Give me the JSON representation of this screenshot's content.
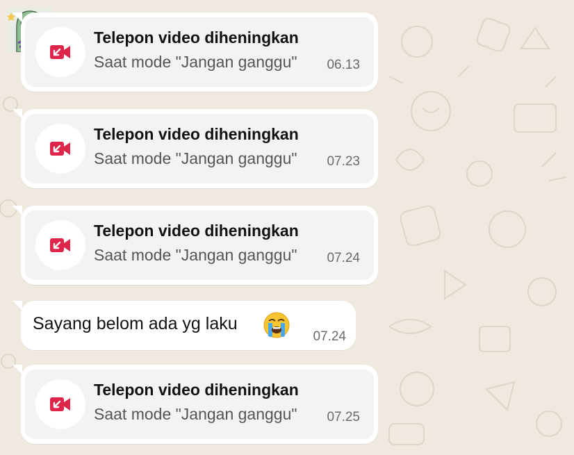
{
  "colors": {
    "background": "#efe9e0",
    "bubble": "#ffffff",
    "call_card": "#f4f3f2",
    "missed_call_icon": "#e0254a",
    "timestamp": "#6a6a6a"
  },
  "avatar": {
    "icon": "green-cartoon-sticker-avatar"
  },
  "messages": [
    {
      "type": "call",
      "title": "Telepon video diheningkan",
      "subtitle": "Saat mode \"Jangan ganggu\"",
      "time": "06.13",
      "icon": "video-call-missed-icon"
    },
    {
      "type": "call",
      "title": "Telepon video diheningkan",
      "subtitle": "Saat mode \"Jangan ganggu\"",
      "time": "07.23",
      "icon": "video-call-missed-icon"
    },
    {
      "type": "call",
      "title": "Telepon video diheningkan",
      "subtitle": "Saat mode \"Jangan ganggu\"",
      "time": "07.24",
      "icon": "video-call-missed-icon"
    },
    {
      "type": "text",
      "text": "Sayang belom ada yg laku",
      "emoji": "loudly-crying-face",
      "time": "07.24"
    },
    {
      "type": "call",
      "title": "Telepon video diheningkan",
      "subtitle": "Saat mode \"Jangan ganggu\"",
      "time": "07.25",
      "icon": "video-call-missed-icon"
    }
  ]
}
